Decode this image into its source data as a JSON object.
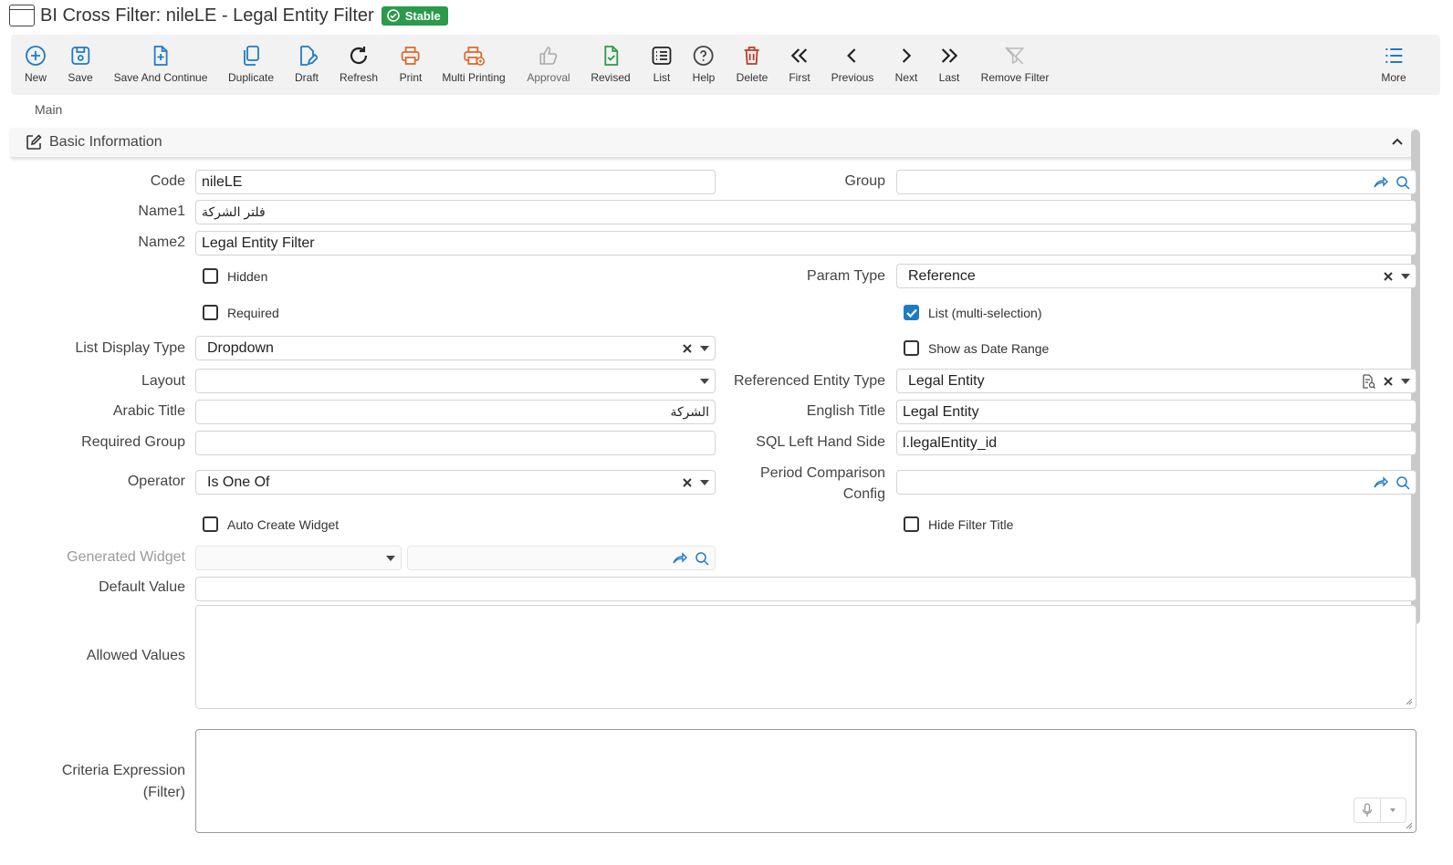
{
  "window": {
    "title": "BI Cross Filter: nileLE - Legal Entity Filter",
    "status_badge": "Stable"
  },
  "toolbar": {
    "new": "New",
    "save": "Save",
    "save_continue": "Save And Continue",
    "duplicate": "Duplicate",
    "draft": "Draft",
    "refresh": "Refresh",
    "print": "Print",
    "multi_printing": "Multi Printing",
    "approval": "Approval",
    "revised": "Revised",
    "list": "List",
    "help": "Help",
    "delete": "Delete",
    "first": "First",
    "previous": "Previous",
    "next": "Next",
    "last": "Last",
    "remove_filter": "Remove Filter",
    "more": "More"
  },
  "tabs": {
    "main": "Main"
  },
  "section": {
    "title": "Basic Information"
  },
  "form": {
    "code": {
      "label": "Code",
      "value": "nileLE"
    },
    "group": {
      "label": "Group",
      "value": ""
    },
    "name1": {
      "label": "Name1",
      "value": "فلتر الشركة"
    },
    "name2": {
      "label": "Name2",
      "value": "Legal Entity Filter"
    },
    "hidden": {
      "label": "Hidden",
      "checked": false
    },
    "param_type": {
      "label": "Param Type",
      "value": "Reference"
    },
    "required": {
      "label": "Required",
      "checked": false
    },
    "list_multi": {
      "label": "List (multi-selection)",
      "checked": true
    },
    "list_display_type": {
      "label": "List Display Type",
      "value": "Dropdown"
    },
    "show_date_range": {
      "label": "Show as Date Range",
      "checked": false
    },
    "layout": {
      "label": "Layout",
      "value": ""
    },
    "ref_entity_type": {
      "label": "Referenced Entity Type",
      "value": "Legal Entity"
    },
    "arabic_title": {
      "label": "Arabic Title",
      "value": "الشركة"
    },
    "english_title": {
      "label": "English Title",
      "value": "Legal Entity"
    },
    "required_group": {
      "label": "Required Group",
      "value": ""
    },
    "sql_lhs": {
      "label": "SQL Left Hand Side",
      "value": "l.legalEntity_id"
    },
    "operator": {
      "label": "Operator",
      "value": "Is One Of"
    },
    "period_comparison": {
      "label_line1": "Period Comparison",
      "label_line2": "Config",
      "value": ""
    },
    "auto_create_widget": {
      "label": "Auto Create Widget",
      "checked": false
    },
    "hide_filter_title": {
      "label": "Hide Filter Title",
      "checked": false
    },
    "generated_widget": {
      "label": "Generated Widget",
      "value": ""
    },
    "default_value": {
      "label": "Default Value",
      "value": ""
    },
    "allowed_values": {
      "label": "Allowed Values",
      "value": ""
    },
    "criteria_expression": {
      "label_line1": "Criteria Expression",
      "label_line2": "(Filter)",
      "value": ""
    }
  },
  "colors": {
    "accent_blue": "#1e7bc6",
    "print_orange": "#e0682a",
    "delete_red": "#c0392b",
    "stable_green": "#2b9a4a"
  }
}
